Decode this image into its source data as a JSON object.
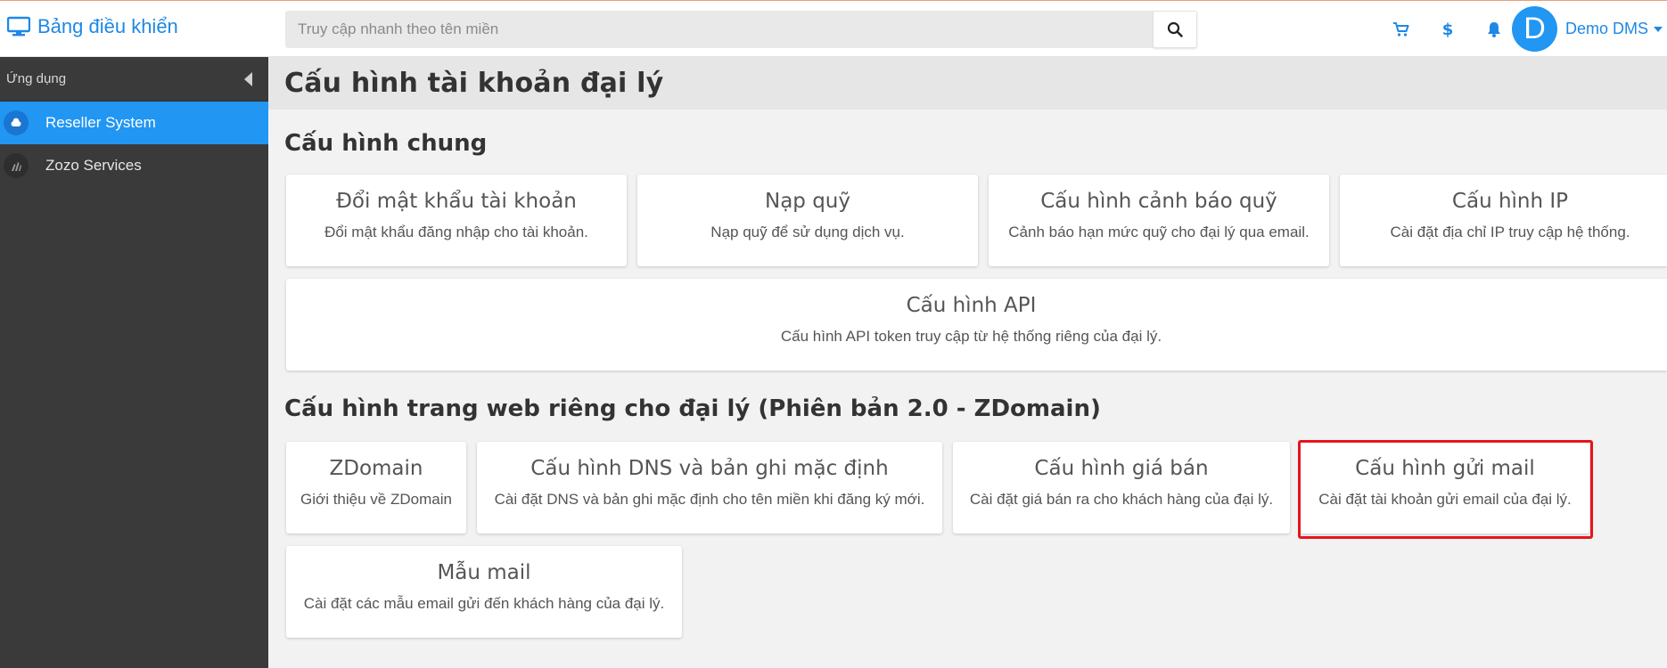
{
  "header": {
    "brand_label": "Bảng điều khiển",
    "search_placeholder": "Truy cập nhanh theo tên miền",
    "avatar_letter": "D",
    "user_name": "Demo DMS"
  },
  "sidebar": {
    "section_label": "Ứng dụng",
    "items": [
      {
        "label": "Reseller System",
        "active": true
      },
      {
        "label": "Zozo Services",
        "active": false
      }
    ]
  },
  "page": {
    "title": "Cấu hình tài khoản đại lý"
  },
  "general": {
    "heading": "Cấu hình chung",
    "cards": [
      {
        "title": "Đổi mật khẩu tài khoản",
        "desc": "Đổi mật khẩu đăng nhập cho tài khoản."
      },
      {
        "title": "Nạp quỹ",
        "desc": "Nạp quỹ để sử dụng dịch vụ."
      },
      {
        "title": "Cấu hình cảnh báo quỹ",
        "desc": "Cảnh báo hạn mức quỹ cho đại lý qua email."
      },
      {
        "title": "Cấu hình IP",
        "desc": "Cài đặt địa chỉ IP truy cập hệ thống."
      },
      {
        "title": "Cấu hình API",
        "desc": "Cấu hình API token truy cập từ hệ thống riêng của đại lý."
      }
    ]
  },
  "website": {
    "heading": "Cấu hình trang web riêng cho đại lý (Phiên bản 2.0 - ZDomain)",
    "cards": [
      {
        "title": "ZDomain",
        "desc": "Giới thiệu về ZDomain"
      },
      {
        "title": "Cấu hình DNS và bản ghi mặc định",
        "desc": "Cài đặt DNS và bản ghi mặc định cho tên miền khi đăng ký mới."
      },
      {
        "title": "Cấu hình giá bán",
        "desc": "Cài đặt giá bán ra cho khách hàng của đại lý."
      },
      {
        "title": "Cấu hình gửi mail",
        "desc": "Cài đặt tài khoản gửi email của đại lý."
      },
      {
        "title": "Mẫu mail",
        "desc": "Cài đặt các mẫu email gửi đến khách hàng của đại lý."
      }
    ]
  },
  "colors": {
    "accent": "#2196f3",
    "sidebar_bg": "#3a3a3a",
    "highlight": "#e8141c"
  }
}
